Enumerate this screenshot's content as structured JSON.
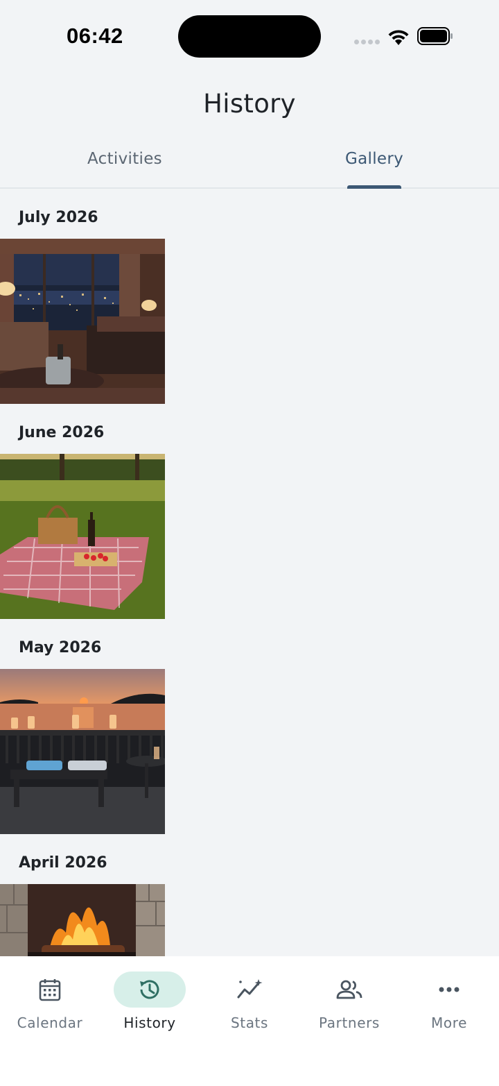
{
  "status": {
    "time": "06:42"
  },
  "header": {
    "title": "History"
  },
  "tabs": [
    {
      "label": "Activities",
      "active": false
    },
    {
      "label": "Gallery",
      "active": true
    }
  ],
  "gallery": {
    "sections": [
      {
        "month": "July 2026",
        "photo": "hotel-room-city-view"
      },
      {
        "month": "June 2026",
        "photo": "park-picnic-sunset"
      },
      {
        "month": "May 2026",
        "photo": "lake-deck-sunset"
      },
      {
        "month": "April 2026",
        "photo": "fireplace"
      }
    ]
  },
  "bottom_nav": [
    {
      "label": "Calendar",
      "icon": "calendar-icon",
      "active": false
    },
    {
      "label": "History",
      "icon": "history-icon",
      "active": true
    },
    {
      "label": "Stats",
      "icon": "stats-icon",
      "active": false
    },
    {
      "label": "Partners",
      "icon": "partners-icon",
      "active": false
    },
    {
      "label": "More",
      "icon": "more-icon",
      "active": false
    }
  ],
  "colors": {
    "background": "#f2f4f6",
    "accent": "#3c5874",
    "nav_active_bg": "#d7efe9",
    "nav_icon": "#4a5560",
    "history_icon": "#2f6f63"
  }
}
